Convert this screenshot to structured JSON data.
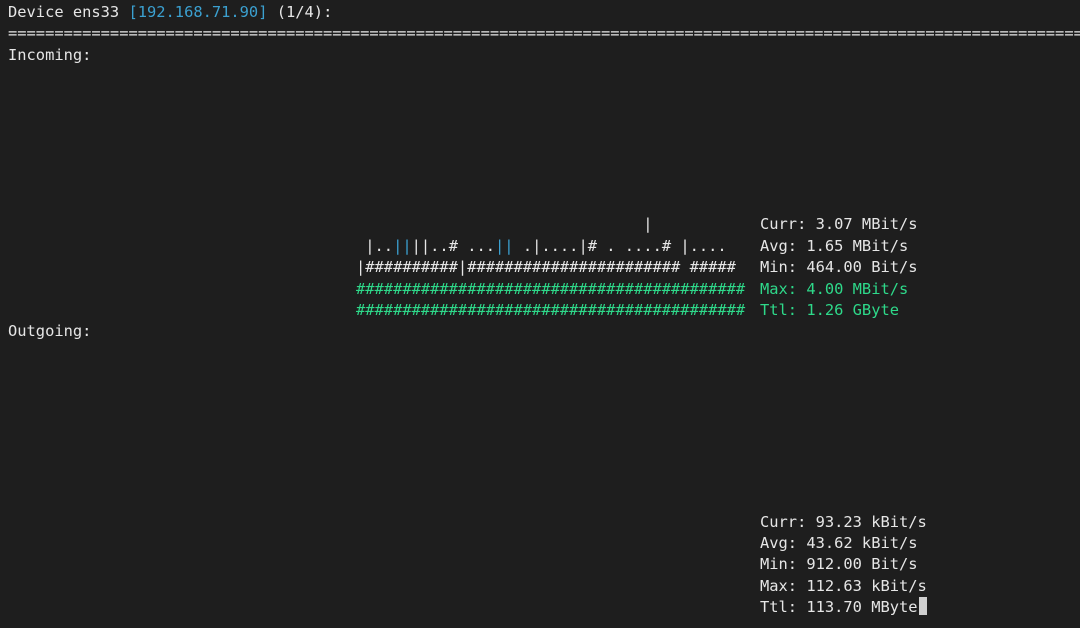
{
  "header": {
    "prefix": "Device ens33 ",
    "ip": "[192.168.71.90]",
    "suffix": " (1/4):",
    "separator": "=============================================================================================================================="
  },
  "incoming": {
    "label": "Incoming:",
    "graph": {
      "row1": "                               |",
      "row2_a": " |..",
      "row2_b": "||",
      "row2_c": "||..# ...",
      "row2_d": "||",
      "row2_e": " .|....|# . ....# |....",
      "row3": "|##########|####################### #####",
      "row4": "##########################################",
      "row5": "##########################################"
    },
    "stats": {
      "curr": "Curr: 3.07 MBit/s",
      "avg": "Avg: 1.65 MBit/s",
      "min": "Min: 464.00 Bit/s",
      "max": "Max: 4.00 MBit/s",
      "ttl": "Ttl: 1.26 GByte"
    }
  },
  "outgoing": {
    "label": "Outgoing:",
    "stats": {
      "curr": "Curr: 93.23 kBit/s",
      "avg": "Avg: 43.62 kBit/s",
      "min": "Min: 912.00 Bit/s",
      "max": "Max: 112.63 kBit/s",
      "ttl": "Ttl: 113.70 MByte"
    }
  },
  "colors": {
    "background": "#1e1e1e",
    "text": "#e6e6e6",
    "ip": "#3ba0d0",
    "highlight": "#2ed98a"
  }
}
